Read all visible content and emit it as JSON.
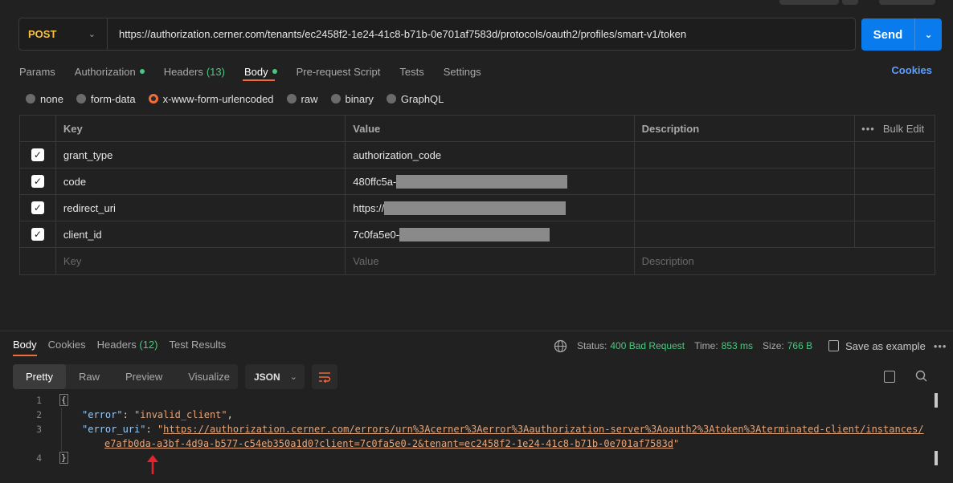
{
  "request": {
    "method": "POST",
    "url": "https://authorization.cerner.com/tenants/ec2458f2-1e24-41c8-b71b-0e701af7583d/protocols/oauth2/profiles/smart-v1/token",
    "send_label": "Send"
  },
  "tabs": [
    {
      "label": "Params",
      "count": "",
      "dot": false
    },
    {
      "label": "Authorization",
      "count": "",
      "dot": true
    },
    {
      "label": "Headers",
      "count": "(13)",
      "dot": false
    },
    {
      "label": "Body",
      "count": "",
      "dot": true
    },
    {
      "label": "Pre-request Script",
      "count": "",
      "dot": false
    },
    {
      "label": "Tests",
      "count": "",
      "dot": false
    },
    {
      "label": "Settings",
      "count": "",
      "dot": false
    }
  ],
  "cookies_link": "Cookies",
  "body_types": [
    "none",
    "form-data",
    "x-www-form-urlencoded",
    "raw",
    "binary",
    "GraphQL"
  ],
  "body_selected": "x-www-form-urlencoded",
  "params": {
    "headers": {
      "key": "Key",
      "value": "Value",
      "description": "Description",
      "bulk_edit": "Bulk Edit"
    },
    "rows": [
      {
        "key": "grant_type",
        "value": "authorization_code",
        "checked": true
      },
      {
        "key": "code",
        "value": "480ffc5a-",
        "checked": true
      },
      {
        "key": "redirect_uri",
        "value": "https://",
        "checked": true
      },
      {
        "key": "client_id",
        "value": "7c0fa5e0-",
        "checked": true
      }
    ],
    "placeholders": {
      "key": "Key",
      "value": "Value",
      "description": "Description"
    }
  },
  "response": {
    "tabs": [
      {
        "label": "Body",
        "count": ""
      },
      {
        "label": "Cookies",
        "count": ""
      },
      {
        "label": "Headers",
        "count": "(12)"
      },
      {
        "label": "Test Results",
        "count": ""
      }
    ],
    "status_label": "Status:",
    "status_value": "400 Bad Request",
    "time_label": "Time:",
    "time_value": "853 ms",
    "size_label": "Size:",
    "size_value": "766 B",
    "save_label": "Save as example",
    "views": [
      "Pretty",
      "Raw",
      "Preview",
      "Visualize"
    ],
    "format": "JSON"
  },
  "code": {
    "line_numbers": [
      "1",
      "2",
      "3",
      "4"
    ],
    "open_brace": "{",
    "close_brace": "}",
    "error_key": "\"error\"",
    "error_value": "\"invalid_client\"",
    "error_uri_key": "\"error_uri\"",
    "error_uri_part1": "https://authorization.cerner.com/errors/urn%3Acerner%3Aerror%3Aauthorization-server%3Aoauth2%3Atoken%3Aterminated-client/instances/",
    "error_uri_part2": "e7afb0da-a3bf-4d9a-b577-c54eb350a1d0?client=7c0fa5e0-2&tenant=ec2458f2-1e24-41c8-b71b-0e701af7583d"
  }
}
